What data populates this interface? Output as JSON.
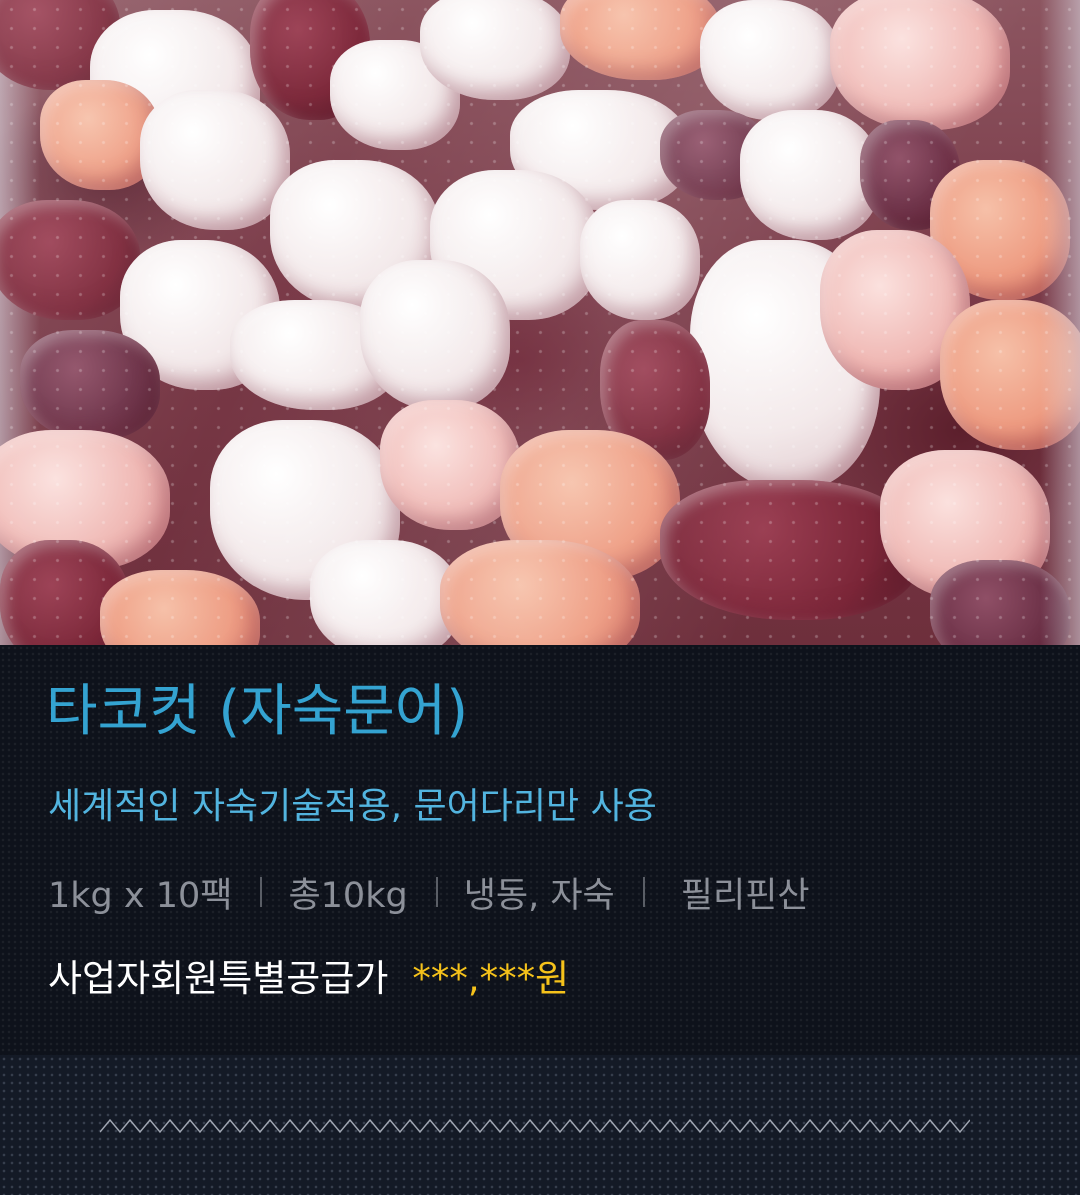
{
  "product": {
    "title": "타코컷 (자숙문어)",
    "subtitle": "세계적인 자숙기술적용, 문어다리만 사용",
    "specs": [
      "1kg x 10팩",
      "총10kg",
      "냉동, 자숙",
      "필리핀산"
    ],
    "price_label": "사업자회원특별공급가",
    "price_value": "***,***원"
  },
  "photo": {
    "icon": "frozen-octopus-pack-photo"
  },
  "colors": {
    "title": "#34a3d1",
    "subtitle": "#52b4df",
    "specs": "#8c9099",
    "price_label": "#ffffff",
    "price_value": "#f5c21b",
    "panel_background": "#0e121b",
    "band_background": "#141a26"
  }
}
